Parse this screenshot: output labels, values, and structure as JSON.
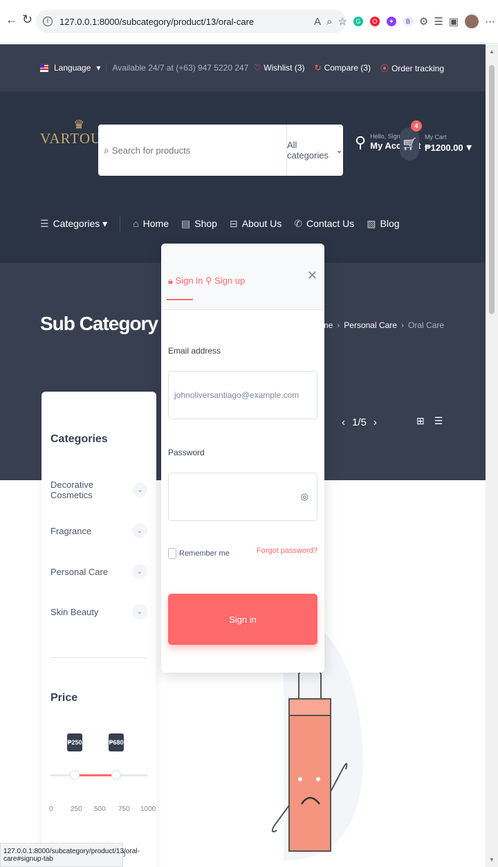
{
  "browser": {
    "url": "127.0.0.1:8000/subcategory/product/13/oral-care",
    "status_url": "127.0.0.1:8000/subcategory/product/13/oral-care#signup-tab"
  },
  "topbar": {
    "language": "Language",
    "availability": "Available 24/7 at (+63) 947 5220 247",
    "wishlist": "Wishlist (3)",
    "compare": "Compare (3)",
    "order_tracking": "Order tracking"
  },
  "header": {
    "logo": "VARTOUHI",
    "search_placeholder": "Search for products",
    "category_select": "All categories",
    "account_greeting": "Hello, Sign in",
    "account_label": "My Account",
    "cart_count": "4",
    "cart_label": "My Cart",
    "cart_total": "₱1200.00"
  },
  "nav": {
    "categories": "Categories",
    "items": [
      "Home",
      "Shop",
      "About Us",
      "Contact Us",
      "Blog"
    ]
  },
  "hero": {
    "title": "Sub Category Products",
    "breadcrumb": [
      "Home",
      "Personal Care",
      "Oral Care"
    ],
    "pager": "1/5"
  },
  "sidebar": {
    "categories_title": "Categories",
    "categories": [
      "Decorative Cosmetics",
      "Fragrance",
      "Personal Care",
      "Skin Beauty"
    ],
    "price_title": "Price",
    "price_min_tag": "₱250",
    "price_max_tag": "₱680",
    "price_ticks": [
      "0",
      "250",
      "500",
      "750",
      "1000"
    ],
    "price_min_input": "0"
  },
  "modal": {
    "tab_signin": "Sign in",
    "tab_signup": "Sign up",
    "email_label": "Email address",
    "email_placeholder": "johnoliversantiago@example.com",
    "password_label": "Password",
    "remember": "Remember me",
    "forgot": "Forgot password?",
    "submit": "Sign in"
  },
  "colors": {
    "accent": "#fe696a",
    "dark": "#2b3445",
    "topbar": "#373f50"
  }
}
